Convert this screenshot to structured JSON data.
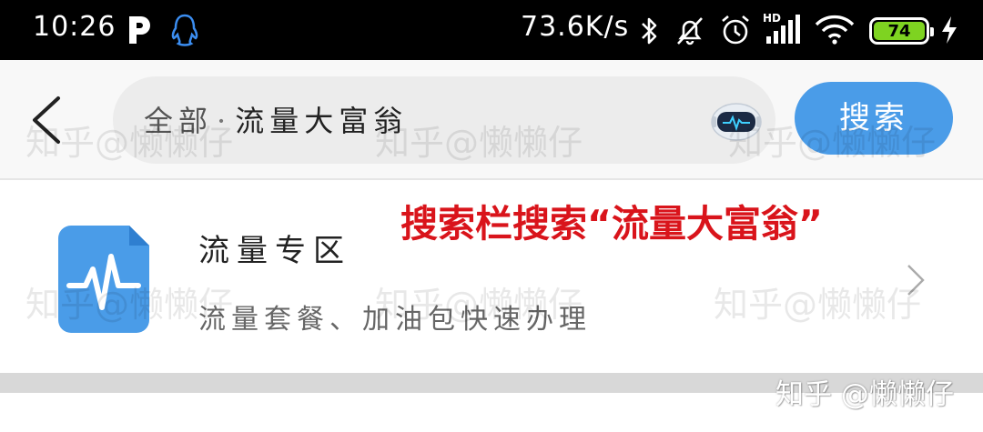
{
  "status_bar": {
    "time": "10:26",
    "network_speed": "73.6K/s",
    "battery_level": "74",
    "icons": [
      "parking-p-icon",
      "qq-penguin-icon",
      "bluetooth-icon",
      "mute-bell-icon",
      "alarm-icon",
      "hd-signal-icon",
      "wifi-icon",
      "battery-icon",
      "charging-bolt-icon"
    ]
  },
  "search": {
    "back_icon": "back-chevron-icon",
    "scope": "全部",
    "separator": "·",
    "query": "流量大富翁",
    "assistant_icon": "robot-assistant-icon",
    "button_label": "搜索"
  },
  "result": {
    "icon": "pulse-wave-icon",
    "icon_color": "#4a9ce8",
    "title": "流量专区",
    "description": "流量套餐、加油包快速办理",
    "arrow_icon": "chevron-right-icon"
  },
  "annotation": {
    "text": "搜索栏搜索“流量大富翁”",
    "color": "#d9141b"
  },
  "watermark": {
    "text": "知乎@懒懒仔",
    "corner_text": "知乎 @懒懒仔"
  }
}
